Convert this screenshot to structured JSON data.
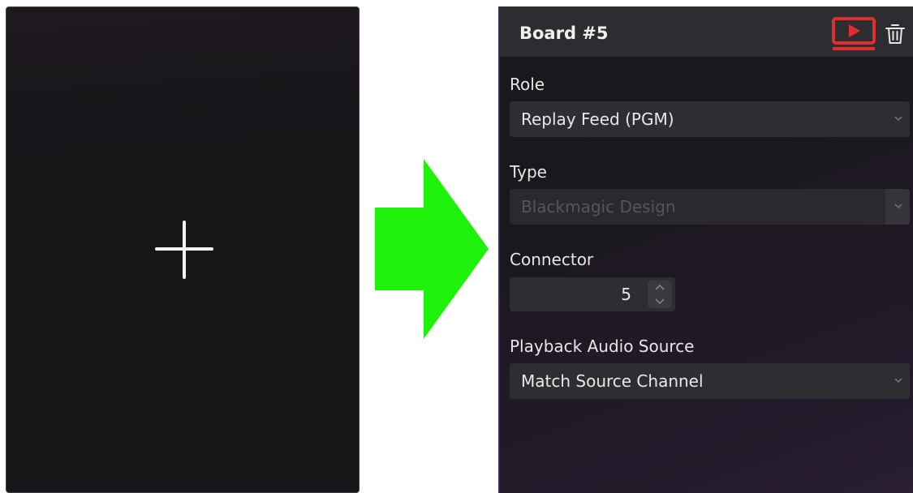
{
  "add_card": {
    "icon": "plus-icon"
  },
  "arrow": {
    "icon": "arrow-right-icon",
    "color": "#1ef20a"
  },
  "panel": {
    "title": "Board #5",
    "live_icon": "play-screen-icon",
    "live_color": "#e02e2e",
    "delete_icon": "trash-icon",
    "role": {
      "label": "Role",
      "value": "Replay Feed (PGM)"
    },
    "type": {
      "label": "Type",
      "value": "Blackmagic Design"
    },
    "connector": {
      "label": "Connector",
      "value": "5"
    },
    "audio": {
      "label": "Playback Audio Source",
      "value": "Match Source Channel"
    }
  }
}
